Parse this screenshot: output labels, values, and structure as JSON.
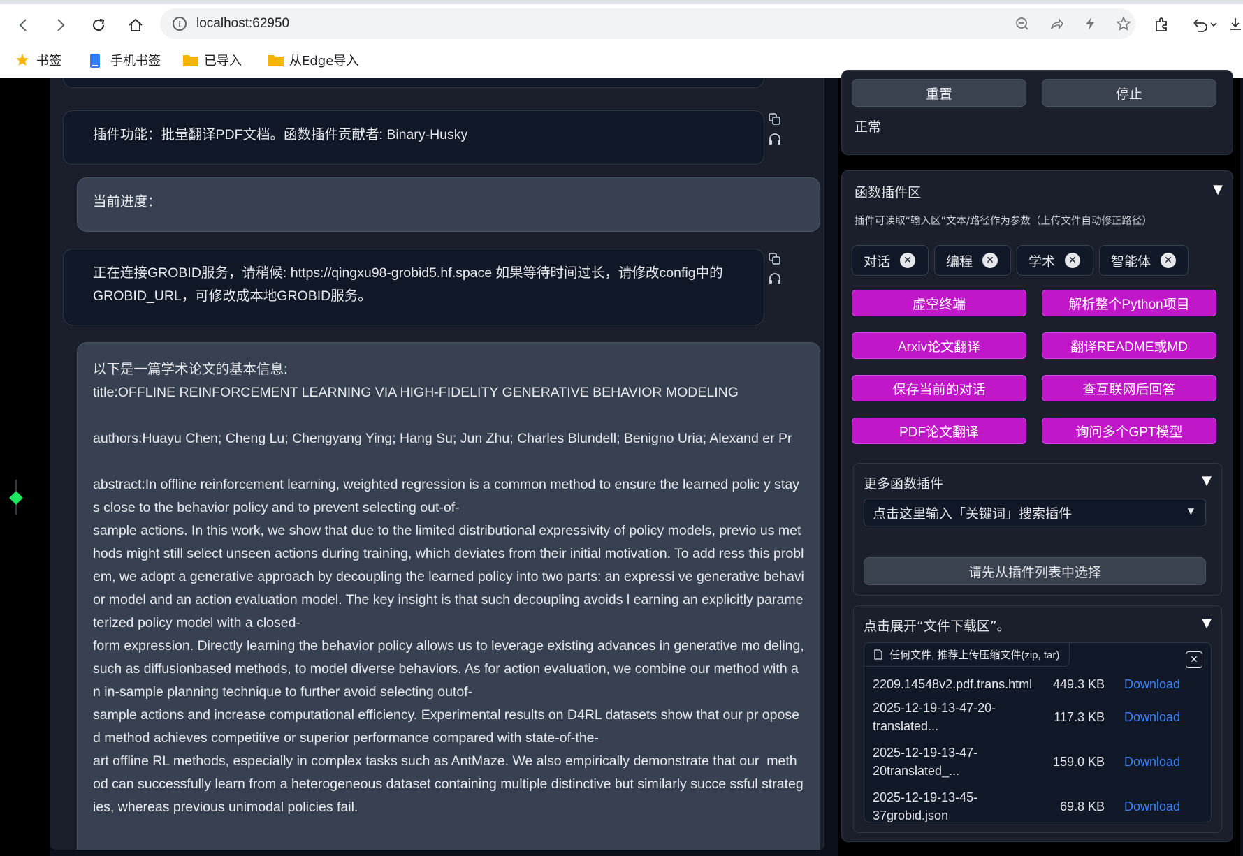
{
  "browser": {
    "url": "localhost:62950",
    "bookmarks": [
      "书签",
      "手机书签",
      "已导入",
      "从Edge导入"
    ]
  },
  "chat": {
    "msg_plugin": "插件功能：批量翻译PDF文档。函数插件贡献者: Binary-Husky",
    "msg_progress": "当前进度：",
    "msg_grobid": "正在连接GROBID服务，请稍候: https://qingxu98-grobid5.hf.space 如果等待时间过长，请修改config中的 GROBID_URL，可修改成本地GROBID服务。",
    "paper_intro": "以下是一篇学术论文的基本信息:",
    "paper_title": "title:OFFLINE REINFORCEMENT LEARNING VIA HIGH-FIDELITY GENERATIVE BEHAVIOR MODELING",
    "paper_authors": "authors:Huayu Chen; Cheng Lu; Chengyang Ying; Hang Su; Jun Zhu; Charles Blundell; Benigno Uria; Alexand er Pr",
    "paper_abstract": "abstract:In offline reinforcement learning, weighted regression is a common method to ensure the learned polic y stays close to the behavior policy and to prevent selecting out-of-\nsample actions. In this work, we show that due to the limited distributional expressivity of policy models, previo us methods might still select unseen actions during training, which deviates from their initial motivation. To add ress this problem, we adopt a generative approach by decoupling the learned policy into two parts: an expressi ve generative behavior model and an action evaluation model. The key insight is that such decoupling avoids l earning an explicitly parameterized policy model with a closed-\nform expression. Directly learning the behavior policy allows us to leverage existing advances in generative mo deling, such as diffusionbased methods, to model diverse behaviors. As for action evaluation, we combine our method with an in-sample planning technique to further avoid selecting outof-\nsample actions and increase computational efficiency. Experimental results on D4RL datasets show that our pr oposed method achieves competitive or superior performance compared with state-of-the-\nart offline RL methods, especially in complex tasks such as AntMaze. We also empirically demonstrate that our  method can successfully learn from a heterogeneous dataset containing multiple distinctive but similarly succe ssful strategies, whereas previous unimodal policies fail."
  },
  "controls": {
    "reset": "重置",
    "stop": "停止",
    "status": "正常"
  },
  "plugins": {
    "title": "函数插件区",
    "hint": "插件可读取“输入区”文本/路径作为参数（上传文件自动修正路径）",
    "chips": [
      "对话",
      "编程",
      "学术",
      "智能体"
    ],
    "buttons": [
      "虚空终端",
      "解析整个Python项目",
      "Arxiv论文翻译",
      "翻译README或MD",
      "保存当前的对话",
      "查互联网后回答",
      "PDF论文翻译",
      "询问多个GPT模型"
    ],
    "more_title": "更多函数插件",
    "search_placeholder": "点击这里输入「关键词」搜索插件",
    "select_first": "请先从插件列表中选择"
  },
  "downloads": {
    "title": "点击展开“文件下载区”。",
    "tag": "任何文件, 推荐上传压缩文件(zip, tar)",
    "files": [
      {
        "name": "2209.14548v2.pdf.trans.html",
        "size": "449.3 KB",
        "link": "Download"
      },
      {
        "name": "2025-12-19-13-47-20-translated...",
        "size": "117.3 KB",
        "link": "Download"
      },
      {
        "name": "2025-12-19-13-47-20translated_...",
        "size": "159.0 KB",
        "link": "Download"
      },
      {
        "name": "2025-12-19-13-45-37grobid.json",
        "size": "69.8 KB",
        "link": "Download"
      }
    ]
  },
  "colors": {
    "accent": "#c017c9",
    "link": "#3b82f6",
    "status_dot": "#1ee85f"
  }
}
